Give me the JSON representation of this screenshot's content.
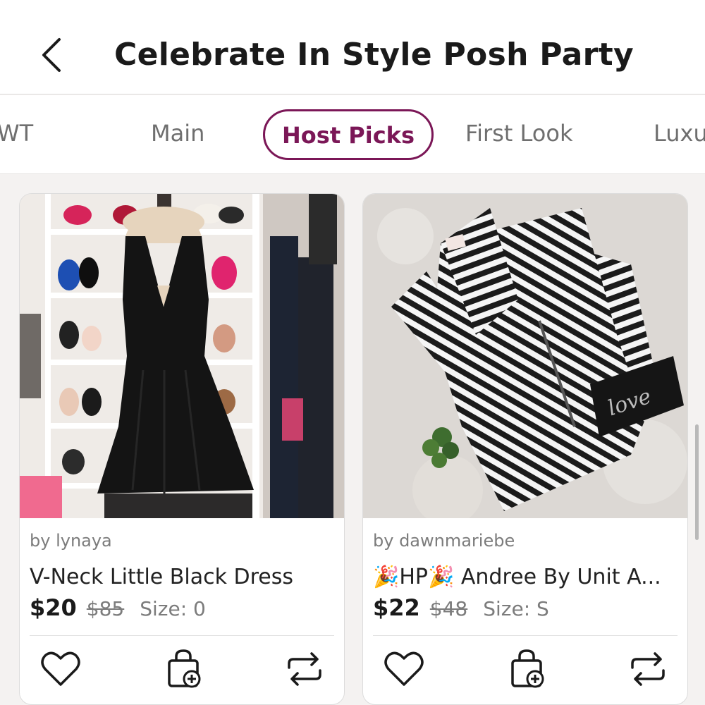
{
  "header": {
    "title": "Celebrate In Style Posh Party",
    "back_icon": "chevron-left-icon"
  },
  "tabs": [
    {
      "label": "WT",
      "active": false
    },
    {
      "label": "Main",
      "active": false
    },
    {
      "label": "Host Picks",
      "active": true
    },
    {
      "label": "First Look",
      "active": false
    },
    {
      "label": "Luxu",
      "active": false
    }
  ],
  "listings": [
    {
      "seller": "by lynaya",
      "title": "V-Neck Little Black Dress",
      "price": "$20",
      "original_price": "$85",
      "size": "Size: 0",
      "actions": [
        "heart-icon",
        "add-to-bundle-icon",
        "share-icon"
      ]
    },
    {
      "seller": "by dawnmariebe",
      "title": "🎉HP🎉 Andree By Unit A...",
      "price": "$22",
      "original_price": "$48",
      "size": "Size: S",
      "photo_text": "love",
      "actions": [
        "heart-icon",
        "add-to-bundle-icon",
        "share-icon"
      ]
    }
  ],
  "colors": {
    "accent": "#7b1757",
    "background": "#f4f2f1"
  }
}
